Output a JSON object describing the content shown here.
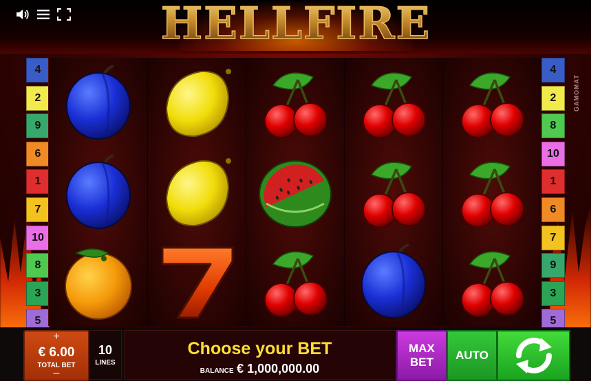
{
  "header": {
    "logo_text": "HELLFIRE",
    "icons": [
      "speaker-icon",
      "menu-icon",
      "fullscreen-icon"
    ]
  },
  "provider": "GAMOMAT",
  "lines_left": [
    {
      "label": "4",
      "color": "#3a5cc7"
    },
    {
      "label": "2",
      "color": "#f2ea4b"
    },
    {
      "label": "9",
      "color": "#36a86b"
    },
    {
      "label": "6",
      "color": "#f08a25"
    },
    {
      "label": "1",
      "color": "#e02e2e"
    },
    {
      "label": "7",
      "color": "#f3c21f"
    },
    {
      "label": "10",
      "color": "#ea6ee6"
    },
    {
      "label": "8",
      "color": "#4fc94f"
    },
    {
      "label": "3",
      "color": "#2aa455"
    },
    {
      "label": "5",
      "color": "#9f6bd9"
    }
  ],
  "lines_right": [
    {
      "label": "4",
      "color": "#3a5cc7"
    },
    {
      "label": "2",
      "color": "#f2ea4b"
    },
    {
      "label": "8",
      "color": "#4fc94f"
    },
    {
      "label": "10",
      "color": "#ea6ee6"
    },
    {
      "label": "1",
      "color": "#e02e2e"
    },
    {
      "label": "6",
      "color": "#f08a25"
    },
    {
      "label": "7",
      "color": "#f3c21f"
    },
    {
      "label": "9",
      "color": "#36a86b"
    },
    {
      "label": "3",
      "color": "#2aa455"
    },
    {
      "label": "5",
      "color": "#9f6bd9"
    }
  ],
  "reels": [
    [
      "plum",
      "plum",
      "orange"
    ],
    [
      "lemon",
      "lemon",
      "seven"
    ],
    [
      "cherry",
      "watermelon",
      "cherry"
    ],
    [
      "cherry",
      "cherry",
      "plum"
    ],
    [
      "cherry",
      "cherry",
      "cherry"
    ]
  ],
  "bottom": {
    "total_bet_plus": "+",
    "total_bet_value": "€ 6.00",
    "total_bet_label": "TOTAL BET",
    "total_bet_minus": "–",
    "lines_value": "10",
    "lines_label": "LINES",
    "message": "Choose your BET",
    "balance_label": "BALANCE",
    "balance_value": "€ 1,000,000.00",
    "max_bet_label_1": "MAX",
    "max_bet_label_2": "BET",
    "auto_label": "AUTO"
  },
  "colors": {
    "total_bet": "#cf4a12",
    "max_bet": "#cc3adf",
    "auto": "#34c83a",
    "spin": "#43db3a",
    "message_text": "#ffe033"
  }
}
